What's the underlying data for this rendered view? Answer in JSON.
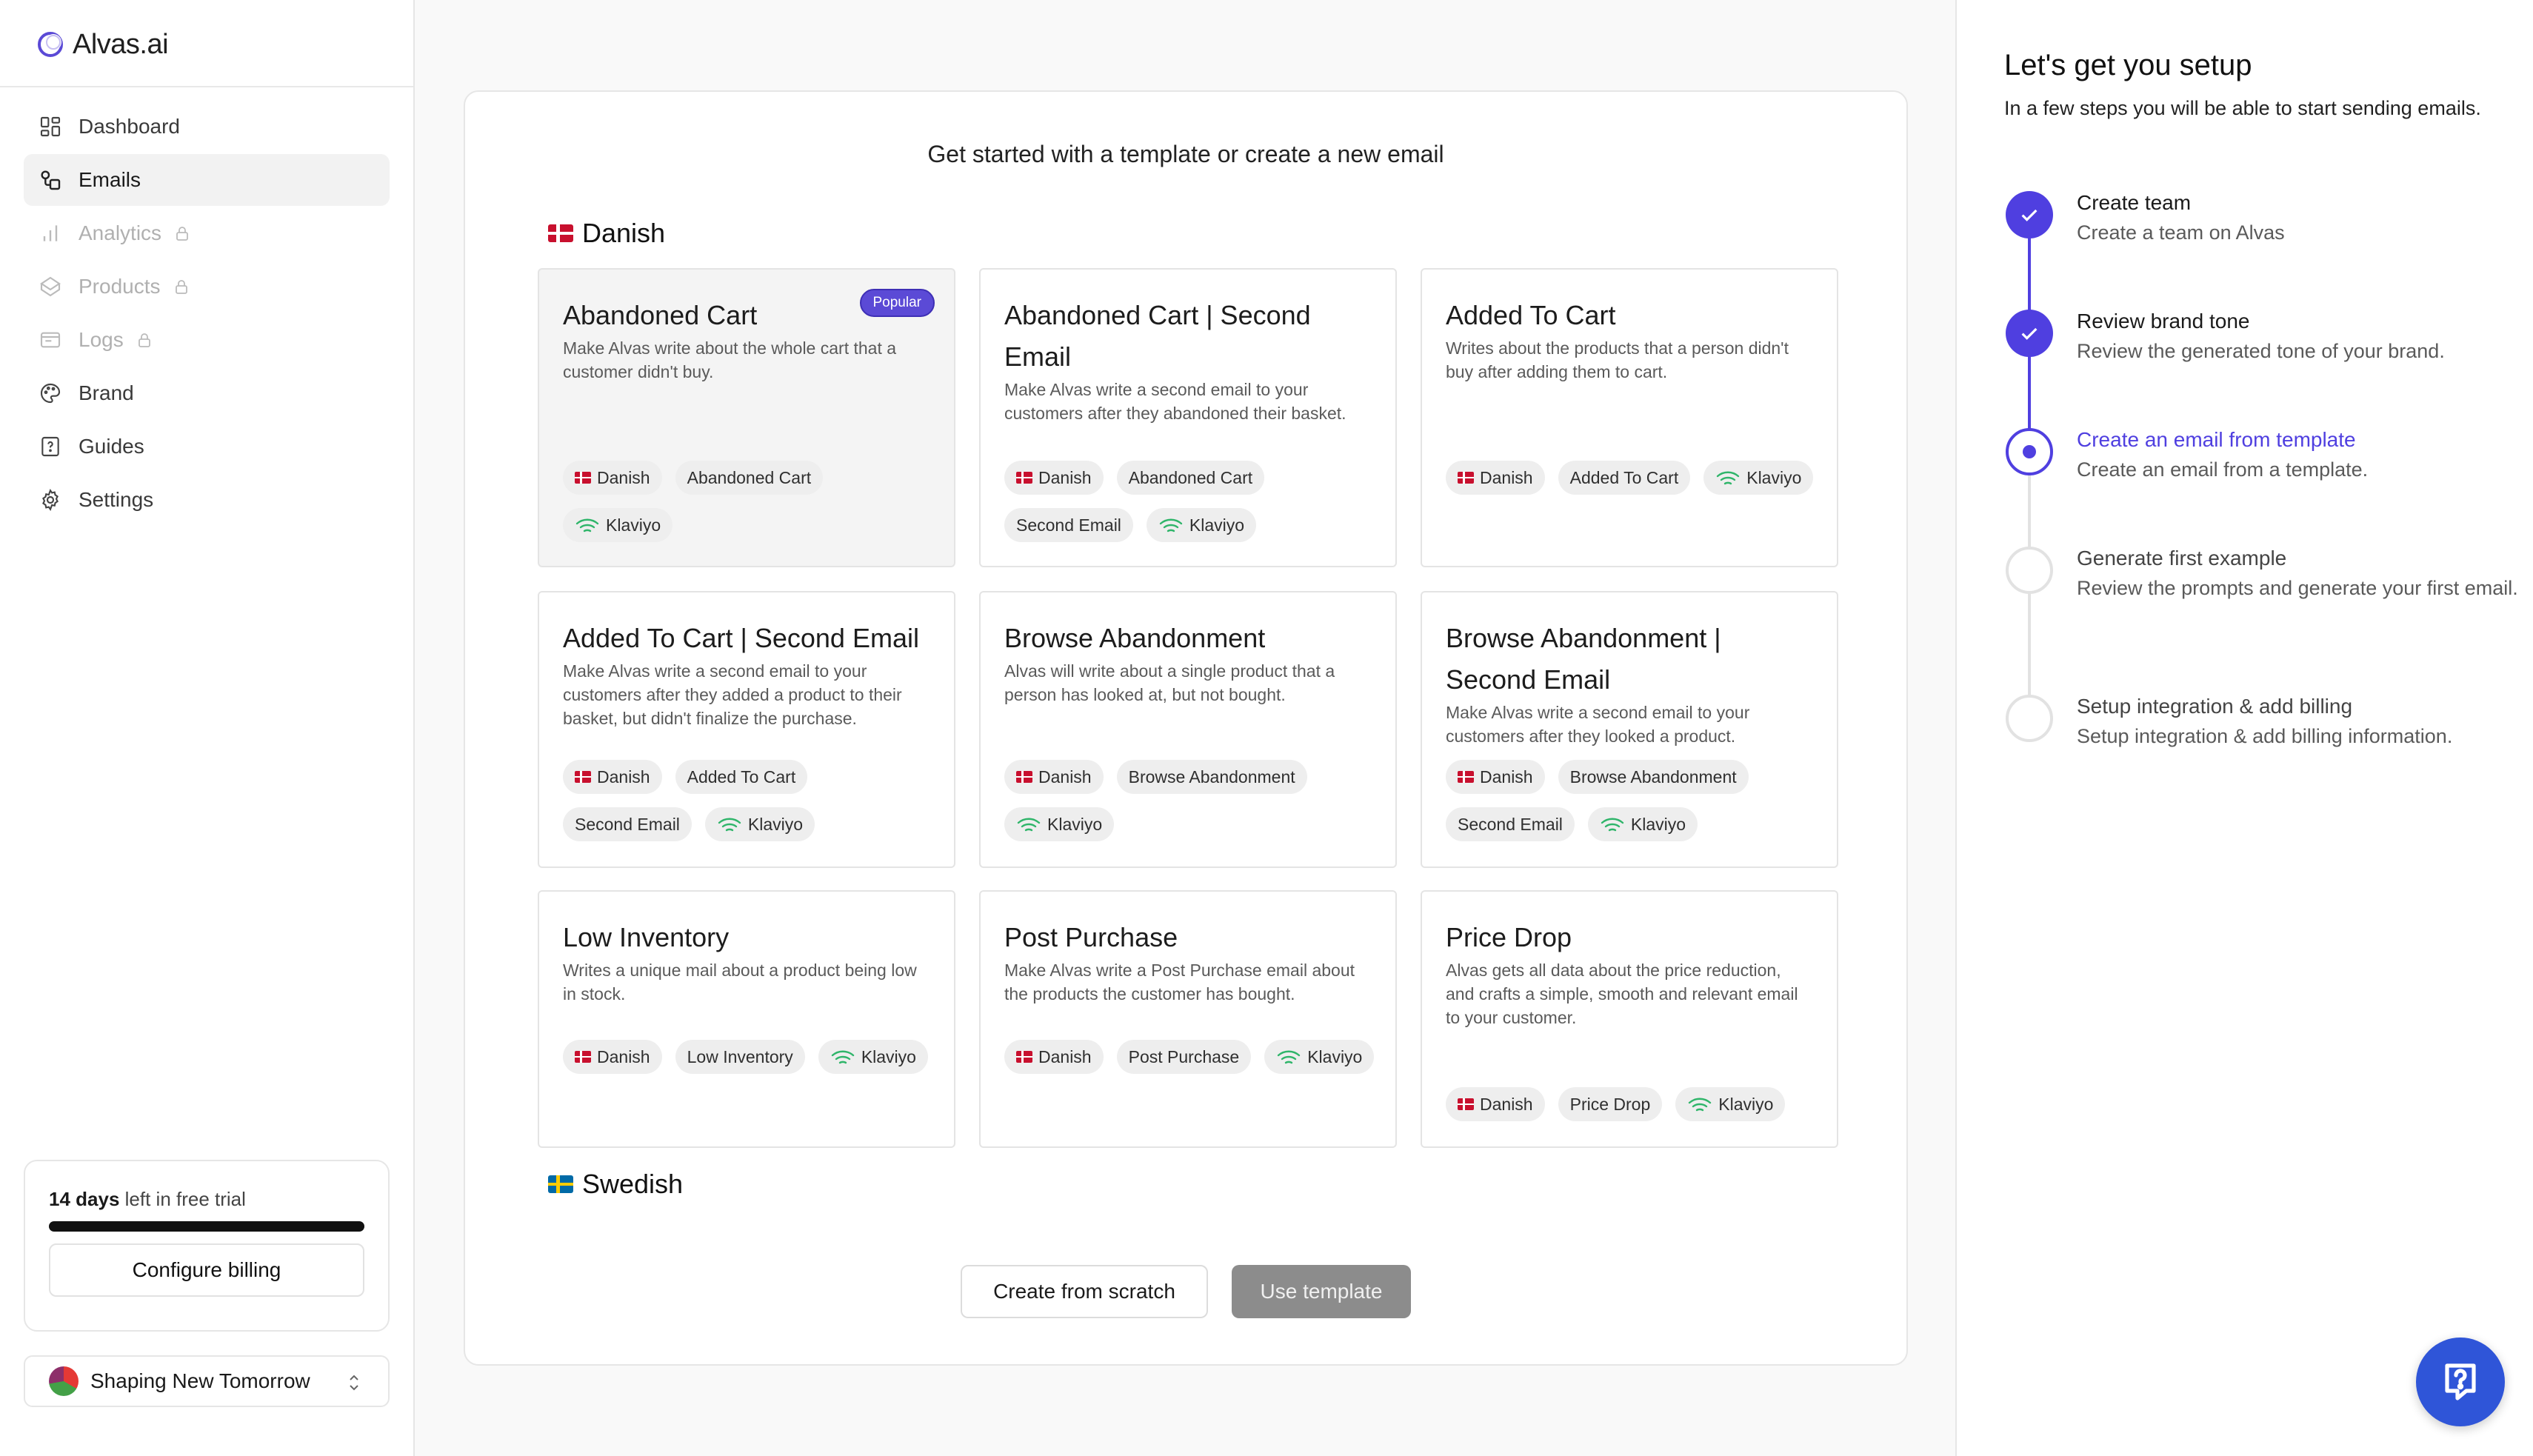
{
  "app": {
    "logo_text": "Alvas.ai"
  },
  "sidebar": {
    "nav": [
      {
        "label": "Dashboard",
        "icon": "dashboard-icon",
        "locked": false,
        "active": false
      },
      {
        "label": "Emails",
        "icon": "emails-icon",
        "locked": false,
        "active": true
      },
      {
        "label": "Analytics",
        "icon": "analytics-icon",
        "locked": true,
        "active": false
      },
      {
        "label": "Products",
        "icon": "products-icon",
        "locked": true,
        "active": false
      },
      {
        "label": "Logs",
        "icon": "logs-icon",
        "locked": true,
        "active": false
      },
      {
        "label": "Brand",
        "icon": "brand-icon",
        "locked": false,
        "active": false
      },
      {
        "label": "Guides",
        "icon": "guides-icon",
        "locked": false,
        "active": false
      },
      {
        "label": "Settings",
        "icon": "settings-icon",
        "locked": false,
        "active": false
      }
    ],
    "trial": {
      "days": "14 days",
      "text": " left in free trial",
      "button": "Configure billing",
      "progress": 1.0
    },
    "team": {
      "name": "Shaping New Tomorrow"
    }
  },
  "main": {
    "heading": "Get started with a template or create a new email",
    "sections": [
      {
        "title": "Danish",
        "flag": "dk"
      },
      {
        "title": "Swedish",
        "flag": "se"
      }
    ],
    "popular_badge": "Popular",
    "templates": [
      {
        "title": "Abandoned Cart",
        "desc": "Make Alvas write about the whole cart that a customer didn't buy.",
        "tags": [
          "Danish",
          "Abandoned Cart",
          "Klaviyo"
        ],
        "selected": true,
        "popular": true
      },
      {
        "title": "Abandoned Cart | Second Email",
        "desc": "Make Alvas write a second email to your customers after they abandoned their basket.",
        "tags": [
          "Danish",
          "Abandoned Cart",
          "Second Email",
          "Klaviyo"
        ]
      },
      {
        "title": "Added To Cart",
        "desc": "Writes about the products that a person didn't buy after adding them to cart.",
        "tags": [
          "Danish",
          "Added To Cart",
          "Klaviyo"
        ]
      },
      {
        "title": "Added To Cart | Second Email",
        "desc": "Make Alvas write a second email to your customers after they added a product to their basket, but didn't finalize the purchase.",
        "tags": [
          "Danish",
          "Added To Cart",
          "Second Email",
          "Klaviyo"
        ]
      },
      {
        "title": "Browse Abandonment",
        "desc": "Alvas will write about a single product that a person has looked at, but not bought.",
        "tags": [
          "Danish",
          "Browse Abandonment",
          "Klaviyo"
        ]
      },
      {
        "title": "Browse Abandonment | Second Email",
        "desc": "Make Alvas write a second email to your customers after they looked a product.",
        "tags": [
          "Danish",
          "Browse Abandonment",
          "Second Email",
          "Klaviyo"
        ]
      },
      {
        "title": "Low Inventory",
        "desc": "Writes a unique mail about a product being low in stock.",
        "tags": [
          "Danish",
          "Low Inventory",
          "Klaviyo"
        ]
      },
      {
        "title": "Post Purchase",
        "desc": "Make Alvas write a Post Purchase email about the products the customer has bought.",
        "tags": [
          "Danish",
          "Post Purchase",
          "Klaviyo"
        ]
      },
      {
        "title": "Price Drop",
        "desc": "Alvas gets all data about the price reduction, and crafts a simple, smooth and relevant email to your customer.",
        "tags": [
          "Danish",
          "Price Drop",
          "Klaviyo"
        ]
      }
    ],
    "buttons": {
      "scratch": "Create from scratch",
      "use": "Use template"
    }
  },
  "setup": {
    "title": "Let's get you setup",
    "subtitle": "In a few steps you will be able to start sending emails.",
    "steps": [
      {
        "name": "Create team",
        "desc": "Create a team on Alvas",
        "status": "done"
      },
      {
        "name": "Review brand tone",
        "desc": "Review the generated tone of your brand.",
        "status": "done"
      },
      {
        "name": "Create an email from template",
        "desc": "Create an email from a template.",
        "status": "current"
      },
      {
        "name": "Generate first example",
        "desc": "Review the prompts and generate your first email.",
        "status": "todo"
      },
      {
        "name": "Setup integration & add billing",
        "desc": "Setup integration & add billing information.",
        "status": "todo"
      }
    ]
  },
  "colors": {
    "accent": "#4f3fe0",
    "help": "#2f55d8",
    "klaviyo": "#2fb56a"
  }
}
